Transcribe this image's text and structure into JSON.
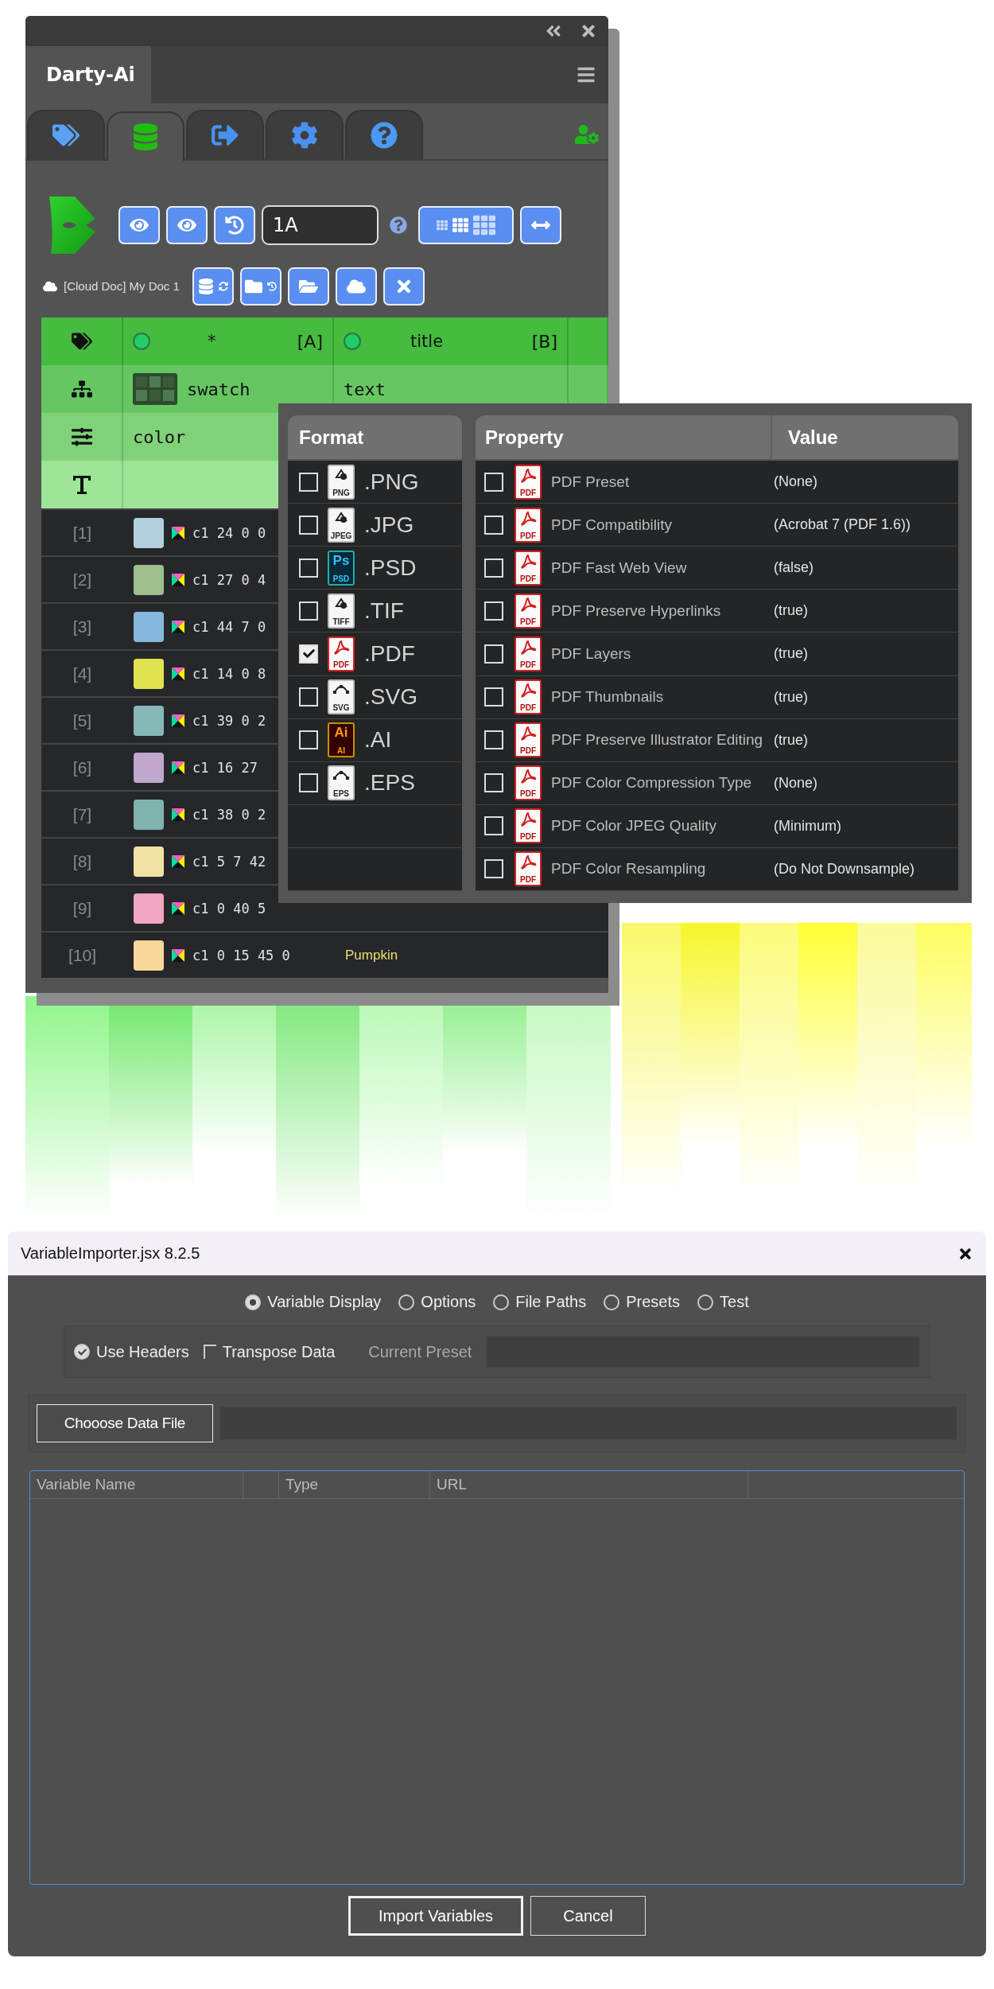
{
  "panel": {
    "title": "Darty-Ai",
    "tabs": [
      {
        "kind": "tags",
        "selected": false
      },
      {
        "kind": "database",
        "selected": true
      },
      {
        "kind": "export",
        "selected": false
      },
      {
        "kind": "settings",
        "selected": false
      },
      {
        "kind": "help",
        "selected": false
      }
    ],
    "id_field": {
      "value": "1A"
    },
    "document": "[Cloud Doc] My Doc 1",
    "columns": [
      {
        "name": "*",
        "ref": "[A]",
        "type": "swatch",
        "format": "color"
      },
      {
        "name": "title",
        "ref": "[B]",
        "type": "text"
      }
    ],
    "rows": [
      {
        "index": "[1]",
        "color": "#b3d0df",
        "value": "c1 24 0 0"
      },
      {
        "index": "[2]",
        "color": "#9dbf8e",
        "value": "c1 27 0 4"
      },
      {
        "index": "[3]",
        "color": "#85b8dc",
        "value": "c1 44 7 0"
      },
      {
        "index": "[4]",
        "color": "#e0e34f",
        "value": "c1 14 0 8"
      },
      {
        "index": "[5]",
        "color": "#86b8b8",
        "value": "c1 39 0 2"
      },
      {
        "index": "[6]",
        "color": "#bfa8cb",
        "value": "c1 16 27"
      },
      {
        "index": "[7]",
        "color": "#80b3ad",
        "value": "c1 38 0 2"
      },
      {
        "index": "[8]",
        "color": "#f0e2a4",
        "value": "c1 5 7 42"
      },
      {
        "index": "[9]",
        "color": "#f2a6c2",
        "value": "c1 0 40 5"
      },
      {
        "index": "[10]",
        "color": "#f7d89b",
        "value": "c1 0 15 45 0",
        "name": "Pumpkin"
      }
    ]
  },
  "export": {
    "format_header": "Format",
    "property_header": "Property",
    "value_header": "Value",
    "formats": [
      {
        "kind": "png",
        "label": ".PNG",
        "icon_label": "PNG",
        "checked": false
      },
      {
        "kind": "jpeg",
        "label": ".JPG",
        "icon_label": "JPEG",
        "checked": false
      },
      {
        "kind": "psd",
        "label": ".PSD",
        "icon_label": "PSD",
        "icon_mark": "Ps",
        "checked": false
      },
      {
        "kind": "tiff",
        "label": ".TIF",
        "icon_label": "TIFF",
        "checked": false
      },
      {
        "kind": "pdf",
        "label": ".PDF",
        "icon_label": "PDF",
        "checked": true
      },
      {
        "kind": "svg",
        "label": ".SVG",
        "icon_label": "SVG",
        "checked": false
      },
      {
        "kind": "ai",
        "label": ".AI",
        "icon_label": "AI",
        "icon_mark": "Ai",
        "checked": false
      },
      {
        "kind": "eps",
        "label": ".EPS",
        "icon_label": "EPS",
        "checked": false
      }
    ],
    "properties": [
      {
        "name": "PDF Preset",
        "value": "(None)",
        "icon_label": "PDF",
        "checked": false
      },
      {
        "name": "PDF Compatibility",
        "value": "(Acrobat 7 (PDF 1.6))",
        "icon_label": "PDF",
        "checked": false
      },
      {
        "name": "PDF Fast Web View",
        "value": "(false)",
        "icon_label": "PDF",
        "checked": false
      },
      {
        "name": "PDF Preserve Hyperlinks",
        "value": "(true)",
        "icon_label": "PDF",
        "checked": false
      },
      {
        "name": "PDF Layers",
        "value": "(true)",
        "icon_label": "PDF",
        "checked": false
      },
      {
        "name": "PDF Thumbnails",
        "value": "(true)",
        "icon_label": "PDF",
        "checked": false
      },
      {
        "name": "PDF Preserve Illustrator Editing",
        "value": "(true)",
        "icon_label": "PDF",
        "checked": false
      },
      {
        "name": "PDF Color Compression Type",
        "value": "(None)",
        "icon_label": "PDF",
        "checked": false
      },
      {
        "name": "PDF Color JPEG Quality",
        "value": "(Minimum)",
        "icon_label": "PDF",
        "checked": false
      },
      {
        "name": "PDF Color Resampling",
        "value": "(Do Not Downsample)",
        "icon_label": "PDF",
        "checked": false
      }
    ]
  },
  "dialog": {
    "title": "VariableImporter.jsx 8.2.5",
    "modes": [
      {
        "label": "Variable Display",
        "selected": true
      },
      {
        "label": "Options",
        "selected": false
      },
      {
        "label": "File Paths",
        "selected": false
      },
      {
        "label": "Presets",
        "selected": false
      },
      {
        "label": "Test",
        "selected": false
      }
    ],
    "use_headers": {
      "label": "Use Headers",
      "checked": true
    },
    "transpose": {
      "label": "Transpose Data",
      "checked": false
    },
    "preset_label": "Current Preset",
    "choose_button": "Chooose Data File",
    "columns": [
      "Variable Name",
      "Type",
      "URL"
    ],
    "buttons": [
      {
        "label": "Import Variables",
        "default": true
      },
      {
        "label": "Cancel",
        "default": false
      }
    ]
  }
}
